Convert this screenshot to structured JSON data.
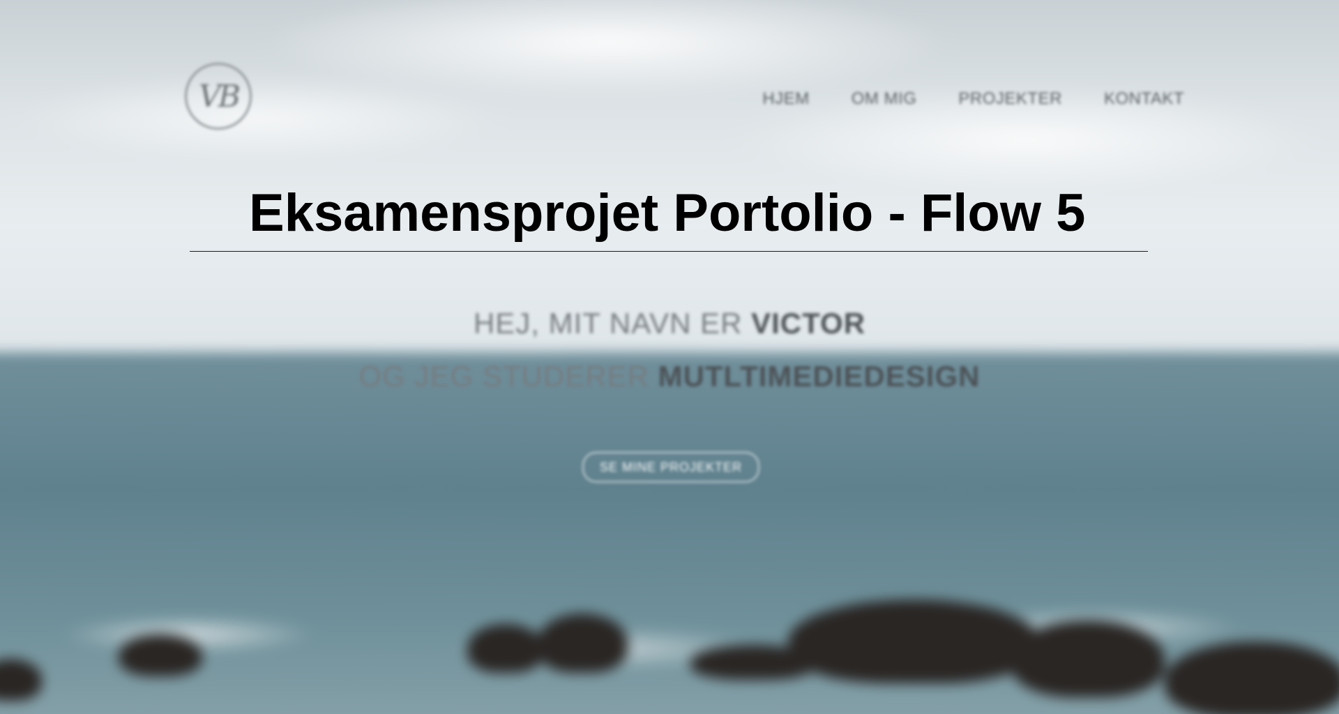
{
  "document": {
    "title": "Eksamensprojet Portolio - Flow 5"
  },
  "site": {
    "logo_text": "VB",
    "nav": [
      {
        "label": "HJEM"
      },
      {
        "label": "OM MIG"
      },
      {
        "label": "PROJEKTER"
      },
      {
        "label": "KONTAKT"
      }
    ],
    "hero": {
      "line1_prefix": "HEJ, MIT NAVN ER",
      "line1_name": "VICTOR",
      "line2_prefix": "OG JEG STUDERER",
      "line2_field": "MUTLTIMEDIEDESIGN",
      "cta_label": "SE MINE PROJEKTER"
    }
  },
  "colors": {
    "title": "#000000",
    "sea": "#5d808d",
    "sky": "#dde3e6",
    "rocks": "#2a2624"
  }
}
